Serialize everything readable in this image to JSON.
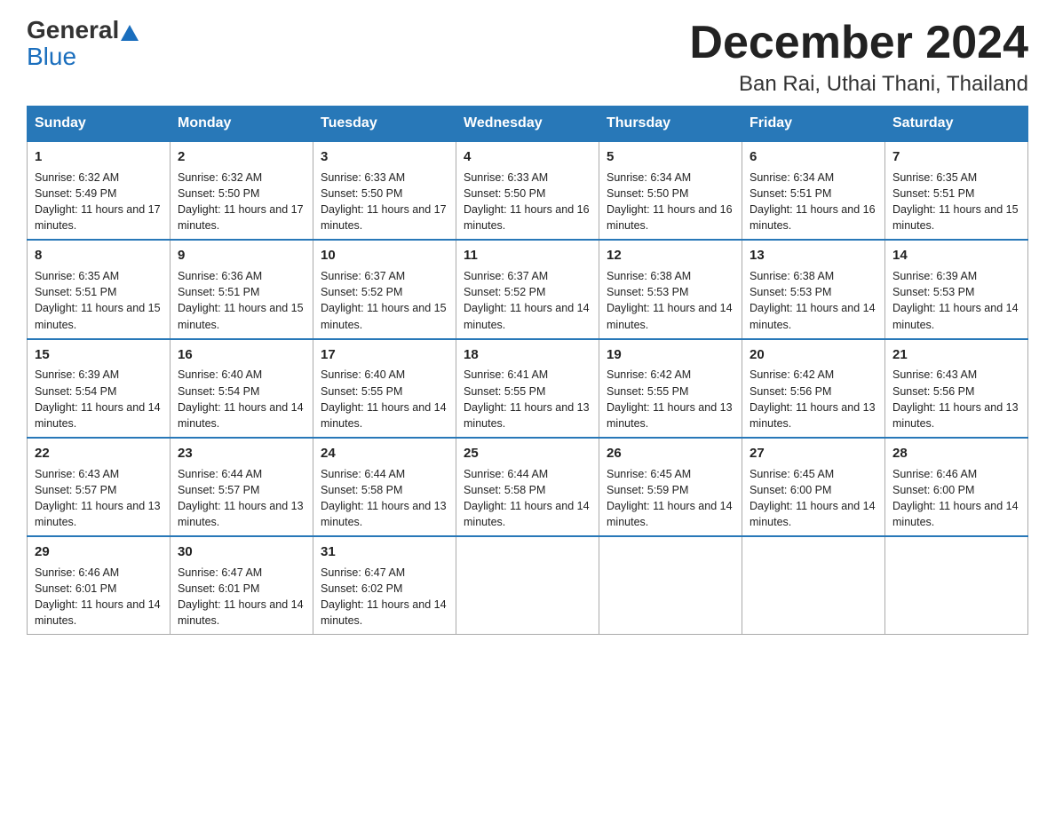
{
  "logo": {
    "general": "General",
    "blue": "Blue"
  },
  "title": "December 2024",
  "location": "Ban Rai, Uthai Thani, Thailand",
  "days_of_week": [
    "Sunday",
    "Monday",
    "Tuesday",
    "Wednesday",
    "Thursday",
    "Friday",
    "Saturday"
  ],
  "weeks": [
    [
      {
        "day": "1",
        "sunrise": "6:32 AM",
        "sunset": "5:49 PM",
        "daylight": "11 hours and 17 minutes."
      },
      {
        "day": "2",
        "sunrise": "6:32 AM",
        "sunset": "5:50 PM",
        "daylight": "11 hours and 17 minutes."
      },
      {
        "day": "3",
        "sunrise": "6:33 AM",
        "sunset": "5:50 PM",
        "daylight": "11 hours and 17 minutes."
      },
      {
        "day": "4",
        "sunrise": "6:33 AM",
        "sunset": "5:50 PM",
        "daylight": "11 hours and 16 minutes."
      },
      {
        "day": "5",
        "sunrise": "6:34 AM",
        "sunset": "5:50 PM",
        "daylight": "11 hours and 16 minutes."
      },
      {
        "day": "6",
        "sunrise": "6:34 AM",
        "sunset": "5:51 PM",
        "daylight": "11 hours and 16 minutes."
      },
      {
        "day": "7",
        "sunrise": "6:35 AM",
        "sunset": "5:51 PM",
        "daylight": "11 hours and 15 minutes."
      }
    ],
    [
      {
        "day": "8",
        "sunrise": "6:35 AM",
        "sunset": "5:51 PM",
        "daylight": "11 hours and 15 minutes."
      },
      {
        "day": "9",
        "sunrise": "6:36 AM",
        "sunset": "5:51 PM",
        "daylight": "11 hours and 15 minutes."
      },
      {
        "day": "10",
        "sunrise": "6:37 AM",
        "sunset": "5:52 PM",
        "daylight": "11 hours and 15 minutes."
      },
      {
        "day": "11",
        "sunrise": "6:37 AM",
        "sunset": "5:52 PM",
        "daylight": "11 hours and 14 minutes."
      },
      {
        "day": "12",
        "sunrise": "6:38 AM",
        "sunset": "5:53 PM",
        "daylight": "11 hours and 14 minutes."
      },
      {
        "day": "13",
        "sunrise": "6:38 AM",
        "sunset": "5:53 PM",
        "daylight": "11 hours and 14 minutes."
      },
      {
        "day": "14",
        "sunrise": "6:39 AM",
        "sunset": "5:53 PM",
        "daylight": "11 hours and 14 minutes."
      }
    ],
    [
      {
        "day": "15",
        "sunrise": "6:39 AM",
        "sunset": "5:54 PM",
        "daylight": "11 hours and 14 minutes."
      },
      {
        "day": "16",
        "sunrise": "6:40 AM",
        "sunset": "5:54 PM",
        "daylight": "11 hours and 14 minutes."
      },
      {
        "day": "17",
        "sunrise": "6:40 AM",
        "sunset": "5:55 PM",
        "daylight": "11 hours and 14 minutes."
      },
      {
        "day": "18",
        "sunrise": "6:41 AM",
        "sunset": "5:55 PM",
        "daylight": "11 hours and 13 minutes."
      },
      {
        "day": "19",
        "sunrise": "6:42 AM",
        "sunset": "5:55 PM",
        "daylight": "11 hours and 13 minutes."
      },
      {
        "day": "20",
        "sunrise": "6:42 AM",
        "sunset": "5:56 PM",
        "daylight": "11 hours and 13 minutes."
      },
      {
        "day": "21",
        "sunrise": "6:43 AM",
        "sunset": "5:56 PM",
        "daylight": "11 hours and 13 minutes."
      }
    ],
    [
      {
        "day": "22",
        "sunrise": "6:43 AM",
        "sunset": "5:57 PM",
        "daylight": "11 hours and 13 minutes."
      },
      {
        "day": "23",
        "sunrise": "6:44 AM",
        "sunset": "5:57 PM",
        "daylight": "11 hours and 13 minutes."
      },
      {
        "day": "24",
        "sunrise": "6:44 AM",
        "sunset": "5:58 PM",
        "daylight": "11 hours and 13 minutes."
      },
      {
        "day": "25",
        "sunrise": "6:44 AM",
        "sunset": "5:58 PM",
        "daylight": "11 hours and 14 minutes."
      },
      {
        "day": "26",
        "sunrise": "6:45 AM",
        "sunset": "5:59 PM",
        "daylight": "11 hours and 14 minutes."
      },
      {
        "day": "27",
        "sunrise": "6:45 AM",
        "sunset": "6:00 PM",
        "daylight": "11 hours and 14 minutes."
      },
      {
        "day": "28",
        "sunrise": "6:46 AM",
        "sunset": "6:00 PM",
        "daylight": "11 hours and 14 minutes."
      }
    ],
    [
      {
        "day": "29",
        "sunrise": "6:46 AM",
        "sunset": "6:01 PM",
        "daylight": "11 hours and 14 minutes."
      },
      {
        "day": "30",
        "sunrise": "6:47 AM",
        "sunset": "6:01 PM",
        "daylight": "11 hours and 14 minutes."
      },
      {
        "day": "31",
        "sunrise": "6:47 AM",
        "sunset": "6:02 PM",
        "daylight": "11 hours and 14 minutes."
      },
      null,
      null,
      null,
      null
    ]
  ]
}
